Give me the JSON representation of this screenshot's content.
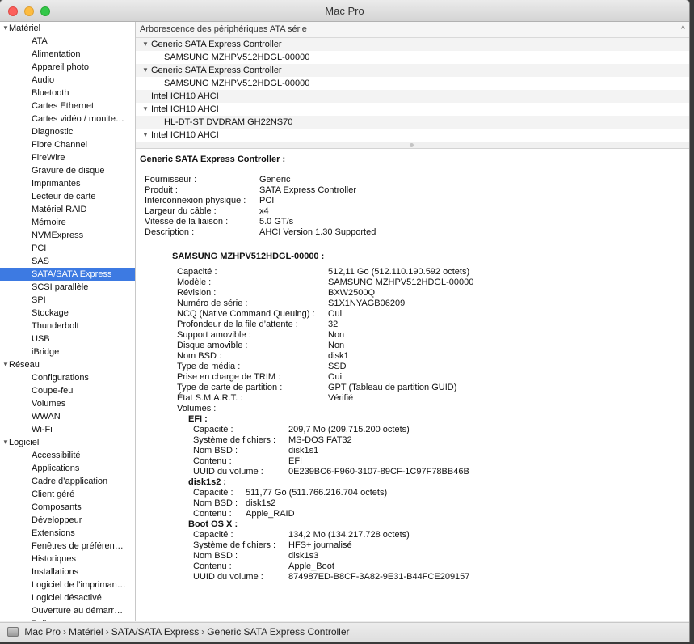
{
  "window": {
    "title": "Mac Pro"
  },
  "sidebar": {
    "hardware": {
      "label": "Matériel",
      "items": [
        "ATA",
        "Alimentation",
        "Appareil photo",
        "Audio",
        "Bluetooth",
        "Cartes Ethernet",
        "Cartes vidéo / monite…",
        "Diagnostic",
        "Fibre Channel",
        "FireWire",
        "Gravure de disque",
        "Imprimantes",
        "Lecteur de carte",
        "Matériel RAID",
        "Mémoire",
        "NVMExpress",
        "PCI",
        "SAS",
        "SATA/SATA Express",
        "SCSI parallèle",
        "SPI",
        "Stockage",
        "Thunderbolt",
        "USB",
        "iBridge"
      ]
    },
    "network": {
      "label": "Réseau",
      "items": [
        "Configurations",
        "Coupe-feu",
        "Volumes",
        "WWAN",
        "Wi-Fi"
      ]
    },
    "software": {
      "label": "Logiciel",
      "items": [
        "Accessibilité",
        "Applications",
        "Cadre d’application",
        "Client géré",
        "Composants",
        "Développeur",
        "Extensions",
        "Fenêtres de préféren…",
        "Historiques",
        "Installations",
        "Logiciel de l’impriman…",
        "Logiciel désactivé",
        "Ouverture au démarr…",
        "Polices"
      ]
    },
    "selected": "SATA/SATA Express"
  },
  "tree": {
    "header": "Arborescence des périphériques ATA série",
    "rows": [
      {
        "label": "Generic SATA Express Controller",
        "level": 1,
        "expanded": true
      },
      {
        "label": "SAMSUNG MZHPV512HDGL-00000",
        "level": 2
      },
      {
        "label": "Generic SATA Express Controller",
        "level": 1,
        "expanded": true
      },
      {
        "label": "SAMSUNG MZHPV512HDGL-00000",
        "level": 2
      },
      {
        "label": "Intel ICH10 AHCI",
        "level": 1,
        "expanded": false
      },
      {
        "label": "Intel ICH10 AHCI",
        "level": 1,
        "expanded": true
      },
      {
        "label": "HL-DT-ST DVDRAM GH22NS70",
        "level": 2
      },
      {
        "label": "Intel ICH10 AHCI",
        "level": 1,
        "expanded": true
      }
    ]
  },
  "detail": {
    "title": "Generic SATA Express Controller :",
    "controller": [
      [
        "Fournisseur :",
        "Generic"
      ],
      [
        "Produit :",
        "SATA Express Controller"
      ],
      [
        "Interconnexion physique :",
        "PCI"
      ],
      [
        "Largeur du câble :",
        "x4"
      ],
      [
        "Vitesse de la liaison :",
        "5.0 GT/s"
      ],
      [
        "Description :",
        "AHCI Version 1.30 Supported"
      ]
    ],
    "device_title": "SAMSUNG MZHPV512HDGL-00000 :",
    "device": [
      [
        "Capacité :",
        "512,11 Go (512.110.190.592 octets)"
      ],
      [
        "Modèle :",
        "SAMSUNG MZHPV512HDGL-00000"
      ],
      [
        "Révision :",
        "BXW2500Q"
      ],
      [
        "Numéro de série :",
        "S1X1NYAGB06209"
      ],
      [
        "NCQ (Native Command Queuing) :",
        "Oui"
      ],
      [
        "Profondeur de la file d’attente :",
        "32"
      ],
      [
        "Support amovible :",
        "Non"
      ],
      [
        "Disque amovible :",
        "Non"
      ],
      [
        "Nom BSD :",
        "disk1"
      ],
      [
        "Type de média :",
        "SSD"
      ],
      [
        "Prise en charge de TRIM :",
        "Oui"
      ],
      [
        "Type de carte de partition :",
        "GPT (Tableau de partition GUID)"
      ],
      [
        "État S.M.A.R.T. :",
        "Vérifié"
      ],
      [
        "Volumes :",
        ""
      ]
    ],
    "volumes": [
      {
        "name": "EFI :",
        "rows": [
          [
            "Capacité :",
            "209,7 Mo (209.715.200 octets)"
          ],
          [
            "Système de fichiers :",
            "MS-DOS FAT32"
          ],
          [
            "Nom BSD :",
            "disk1s1"
          ],
          [
            "Contenu :",
            "EFI"
          ],
          [
            "UUID du volume :",
            "0E239BC6-F960-3107-89CF-1C97F78BB46B"
          ]
        ]
      },
      {
        "name": "disk1s2 :",
        "rows": [
          [
            "Capacité :",
            "511,77 Go (511.766.216.704 octets)"
          ],
          [
            "Nom BSD :",
            "disk1s2"
          ],
          [
            "Contenu :",
            "Apple_RAID"
          ]
        ]
      },
      {
        "name": "Boot OS X :",
        "rows": [
          [
            "Capacité :",
            "134,2 Mo (134.217.728 octets)"
          ],
          [
            "Système de fichiers :",
            "HFS+ journalisé"
          ],
          [
            "Nom BSD :",
            "disk1s3"
          ],
          [
            "Contenu :",
            "Apple_Boot"
          ],
          [
            "UUID du volume :",
            "874987ED-B8CF-3A82-9E31-B44FCE209157"
          ]
        ]
      }
    ]
  },
  "statusbar": {
    "path": [
      "Mac Pro",
      "Matériel",
      "SATA/SATA Express",
      "Generic SATA Express Controller"
    ],
    "separator": "›"
  },
  "colors": {
    "selection": "#3d7ae2",
    "close": "#fc605c",
    "minimize": "#fdbc40",
    "maximize": "#34c84a"
  }
}
